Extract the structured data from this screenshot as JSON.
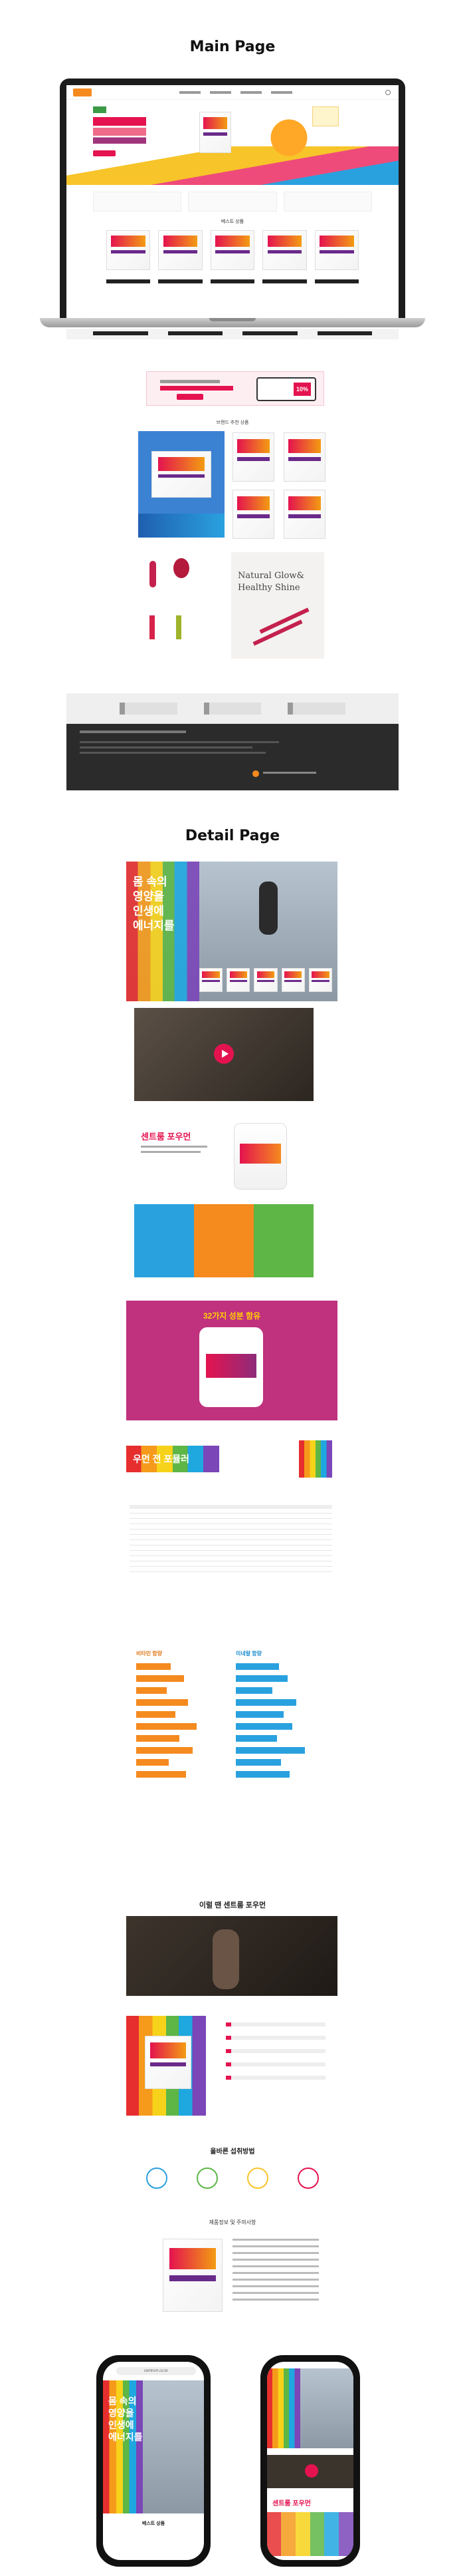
{
  "headings": {
    "main": "Main Page",
    "detail": "Detail Page"
  },
  "main_page": {
    "nav": [
      "",
      "",
      "",
      ""
    ],
    "hero_button": "",
    "section_best": "베스트 상품",
    "section_brand": "브랜드 추천 상품",
    "promo_badge": "10%",
    "promo_button": "",
    "natural_glow": {
      "line1": "Natural Glow&",
      "line2": "Healthy Shine"
    },
    "footer_logo_text": ""
  },
  "detail_page": {
    "hero_text": [
      "몸 속의",
      "영양을",
      "인생에",
      "에너지를"
    ],
    "product_name": "센트룸 포우먼",
    "benefits_title": "32가지 성분 함유",
    "slogan": "우먼 전 포뮬러",
    "chart_left_title": "비타민 함량",
    "chart_right_title": "미네랄 함량",
    "section_why": "이럴 땐 센트룸 포우먼",
    "section_howto": "올바른 섭취방법",
    "section_info": "제품정보 및 주의사항"
  },
  "mobile": {
    "url": "centrum.co.kr",
    "bottom_label": "베스트 상품",
    "hero_text": [
      "몸 속의",
      "영양을",
      "인생에",
      "에너지를"
    ],
    "product_name": "센트룸 포우먼"
  },
  "colors": {
    "brand_red": "#e4134f",
    "brand_orange": "#f58a1f",
    "brand_blue": "#2aa1df",
    "brand_purple": "#c0317e",
    "footer_dark": "#2b2b2b"
  }
}
